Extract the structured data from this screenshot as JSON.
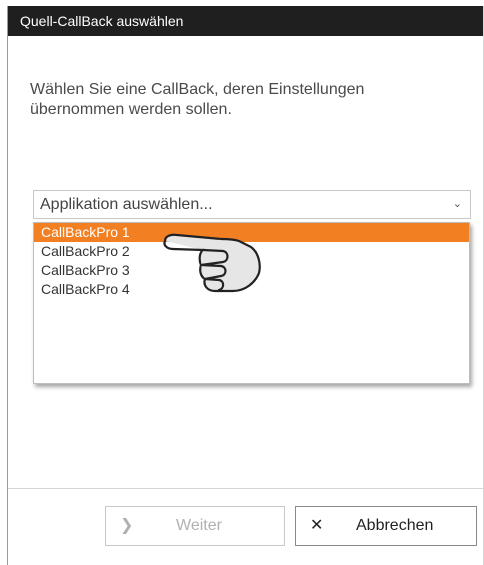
{
  "dialog": {
    "title": "Quell-CallBack auswählen",
    "description": "Wählen Sie eine CallBack, deren Einstellungen übernommen werden sollen."
  },
  "select": {
    "placeholder": "Applikation auswählen...",
    "chevron_icon": "chevron-down-icon",
    "options": [
      "CallBackPro 1",
      "CallBackPro 2",
      "CallBackPro 3",
      "CallBackPro 4"
    ],
    "highlighted_option": "CallBackPro 1"
  },
  "buttons": {
    "next_label": "Weiter",
    "next_icon": "chevron-right-icon",
    "cancel_label": "Abbrechen",
    "cancel_icon": "close-icon"
  },
  "colors": {
    "titlebar": "#1f1f1f",
    "highlight": "#f28022"
  }
}
